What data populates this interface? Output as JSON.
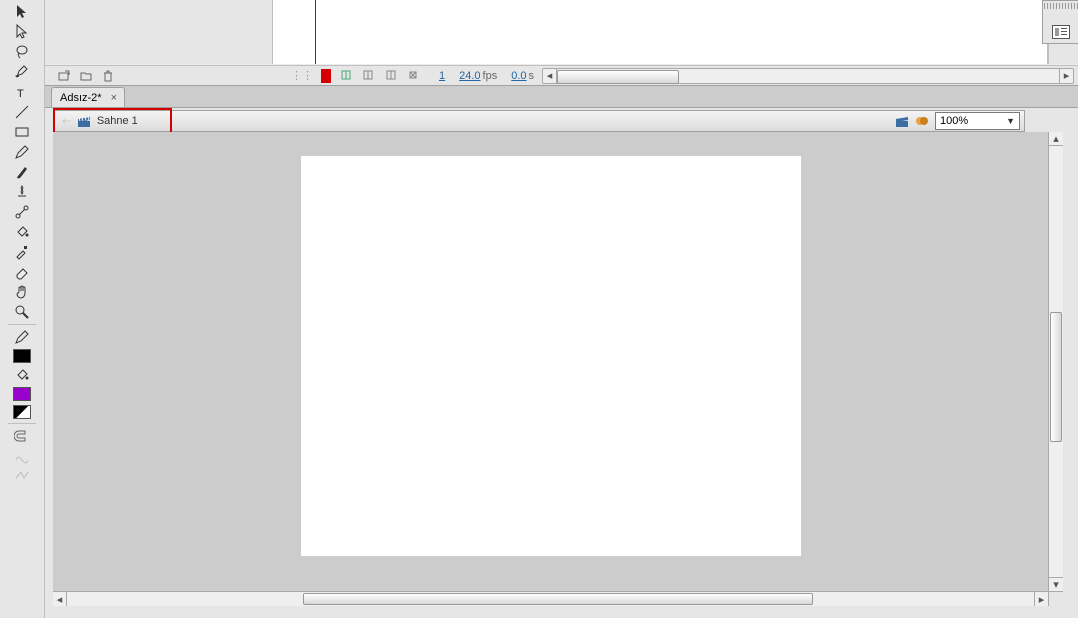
{
  "document": {
    "tab_label": "Adsız-2*"
  },
  "scene": {
    "name": "Sahne 1",
    "zoom": "100%"
  },
  "timeline": {
    "current_frame": "1",
    "fps_value": "24.0",
    "fps_label": "fps",
    "time_value": "0.0",
    "time_label": "s"
  },
  "tools": [
    "selection-tool",
    "subselection-tool",
    "lasso-tool",
    "pen-tool",
    "text-tool",
    "line-tool",
    "rectangle-tool",
    "pencil-tool",
    "brush-tool",
    "deco-tool",
    "bone-tool",
    "paint-bucket-tool",
    "eyedropper-tool",
    "eraser-tool",
    "hand-tool",
    "zoom-tool"
  ],
  "colors": {
    "stroke": "#000000",
    "fill": "#9900cc"
  }
}
